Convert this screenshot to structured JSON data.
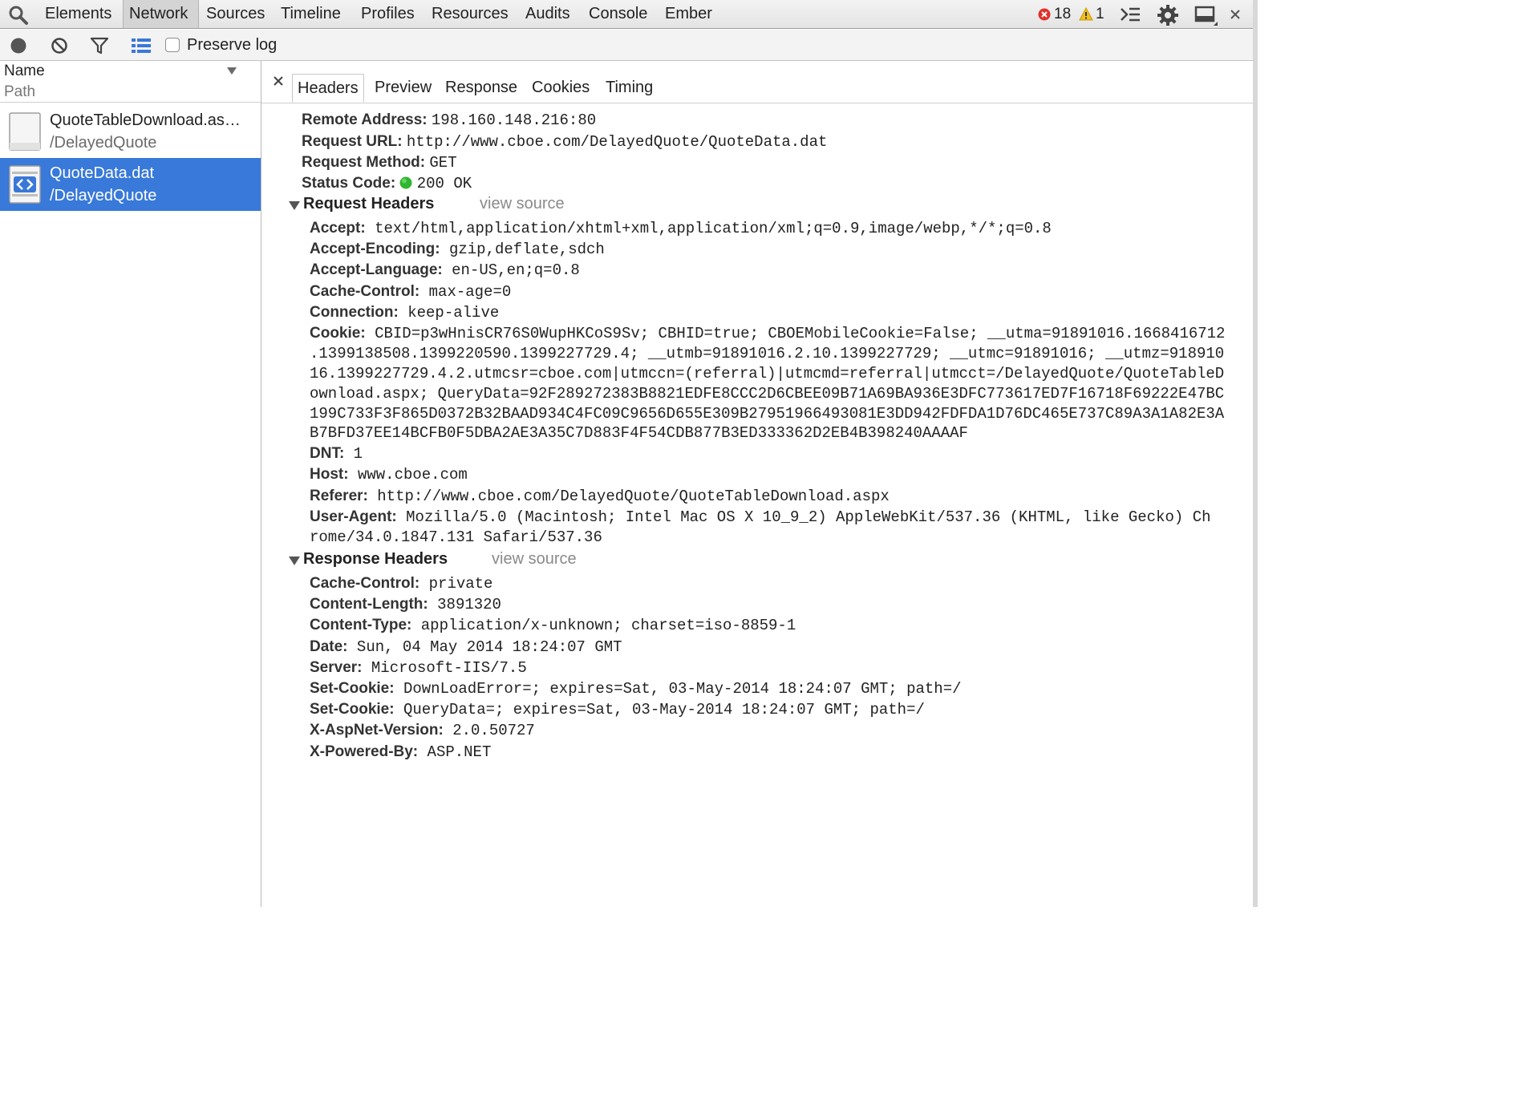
{
  "toolbar": {
    "tabs": [
      "Elements",
      "Network",
      "Sources",
      "Timeline",
      "Profiles",
      "Resources",
      "Audits",
      "Console",
      "Ember"
    ],
    "active_tab": "Network",
    "error_count": "18",
    "warning_count": "1"
  },
  "network_toolbar": {
    "preserve_log_label": "Preserve log"
  },
  "request_list": {
    "column_name": "Name",
    "column_path": "Path",
    "items": [
      {
        "name": "QuoteTableDownload.as…",
        "path": "/DelayedQuote",
        "selected": false
      },
      {
        "name": "QuoteData.dat",
        "path": "/DelayedQuote",
        "selected": true
      }
    ]
  },
  "detail_tabs": [
    "Headers",
    "Preview",
    "Response",
    "Cookies",
    "Timing"
  ],
  "general": {
    "remote_address": {
      "key": "Remote Address:",
      "value": "198.160.148.216:80"
    },
    "request_url": {
      "key": "Request URL:",
      "value": "http://www.cboe.com/DelayedQuote/QuoteData.dat"
    },
    "request_method": {
      "key": "Request Method:",
      "value": "GET"
    },
    "status_code": {
      "key": "Status Code:",
      "value": "200 OK",
      "dot_color": "#2fb52f"
    }
  },
  "request_headers": {
    "title": "Request Headers",
    "view_source": "view source",
    "items": [
      {
        "key": "Accept:",
        "value": "text/html,application/xhtml+xml,application/xml;q=0.9,image/webp,*/*;q=0.8"
      },
      {
        "key": "Accept-Encoding:",
        "value": "gzip,deflate,sdch"
      },
      {
        "key": "Accept-Language:",
        "value": "en-US,en;q=0.8"
      },
      {
        "key": "Cache-Control:",
        "value": "max-age=0"
      },
      {
        "key": "Connection:",
        "value": "keep-alive"
      },
      {
        "key": "Cookie:",
        "value": "CBID=p3wHnisCR76S0WupHKCoS9Sv; CBHID=true; CBOEMobileCookie=False; __utma=91891016.1668416712",
        "continuation": [
          ".1399138508.1399220590.1399227729.4; __utmb=91891016.2.10.1399227729; __utmc=91891016; __utmz=918910",
          "16.1399227729.4.2.utmcsr=cboe.com|utmccn=(referral)|utmcmd=referral|utmcct=/DelayedQuote/QuoteTableD",
          "ownload.aspx; QueryData=92F289272383B8821EDFE8CCC2D6CBEE09B71A69BA936E3DFC773617ED7F16718F69222E47BC",
          "199C733F3F865D0372B32BAAD934C4FC09C9656D655E309B27951966493081E3DD942FDFDA1D76DC465E737C89A3A1A82E3A",
          "B7BFD37EE14BCFB0F5DBA2AE3A35C7D883F4F54CDB877B3ED333362D2EB4B398240AAAAF"
        ]
      },
      {
        "key": "DNT:",
        "value": "1"
      },
      {
        "key": "Host:",
        "value": "www.cboe.com"
      },
      {
        "key": "Referer:",
        "value": "http://www.cboe.com/DelayedQuote/QuoteTableDownload.aspx"
      },
      {
        "key": "User-Agent:",
        "value": "Mozilla/5.0 (Macintosh; Intel Mac OS X 10_9_2) AppleWebKit/537.36 (KHTML, like Gecko) Ch",
        "continuation": [
          "rome/34.0.1847.131 Safari/537.36"
        ]
      }
    ]
  },
  "response_headers": {
    "title": "Response Headers",
    "view_source": "view source",
    "items": [
      {
        "key": "Cache-Control:",
        "value": "private"
      },
      {
        "key": "Content-Length:",
        "value": "3891320"
      },
      {
        "key": "Content-Type:",
        "value": "application/x-unknown; charset=iso-8859-1"
      },
      {
        "key": "Date:",
        "value": "Sun, 04 May 2014 18:24:07 GMT"
      },
      {
        "key": "Server:",
        "value": "Microsoft-IIS/7.5"
      },
      {
        "key": "Set-Cookie:",
        "value": "DownLoadError=; expires=Sat, 03-May-2014 18:24:07 GMT; path=/"
      },
      {
        "key": "Set-Cookie:",
        "value": "QueryData=; expires=Sat, 03-May-2014 18:24:07 GMT; path=/"
      },
      {
        "key": "X-AspNet-Version:",
        "value": "2.0.50727"
      },
      {
        "key": "X-Powered-By:",
        "value": "ASP.NET"
      }
    ]
  },
  "icons": {
    "search": "search-icon",
    "error": "error-icon",
    "warning": "warning-icon",
    "drawer": "console-drawer-icon",
    "settings": "gear-icon",
    "dock": "dock-icon",
    "close": "close-icon",
    "record": "record-icon",
    "clear": "clear-icon",
    "filter": "filter-icon",
    "large_rows": "large-rows-icon"
  }
}
